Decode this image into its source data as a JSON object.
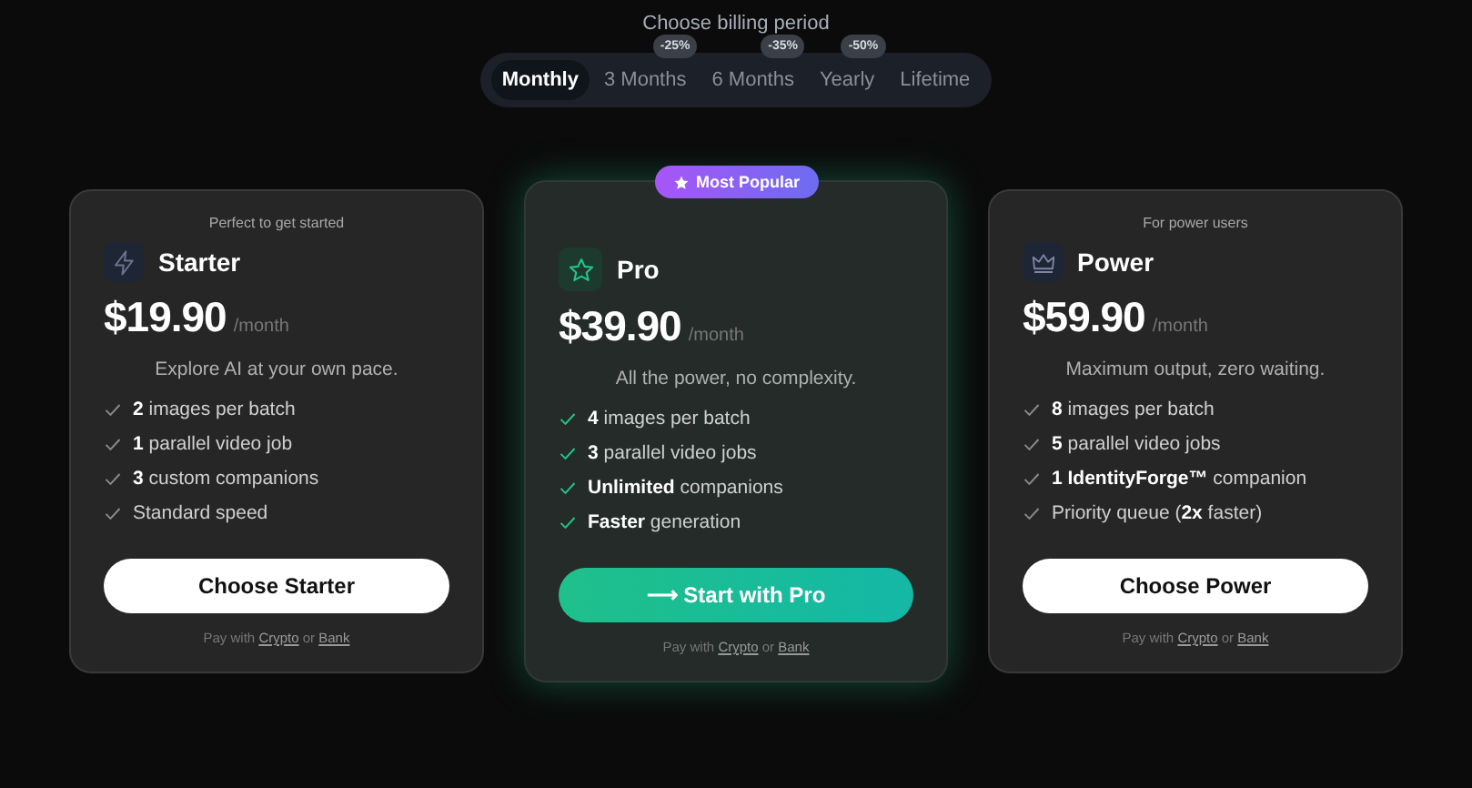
{
  "billing": {
    "heading": "Choose billing period",
    "periods": [
      {
        "label": "Monthly",
        "selected": true
      },
      {
        "label": "3 Months",
        "selected": false,
        "discount": "-25%"
      },
      {
        "label": "6 Months",
        "selected": false,
        "discount": "-35%"
      },
      {
        "label": "Yearly",
        "selected": false,
        "discount": "-50%"
      },
      {
        "label": "Lifetime",
        "selected": false
      }
    ]
  },
  "plans": [
    {
      "tagline": "Perfect to get started",
      "name": "Starter",
      "price": "$19.90",
      "unit": "/month",
      "description": "Explore AI at your own pace.",
      "featured": false,
      "features": [
        "**2** images per batch",
        "**1** parallel video job",
        "**3** custom companions",
        "Standard speed"
      ],
      "button": "Choose Starter",
      "pay": {
        "prefix": "Pay with",
        "link_1": "Crypto",
        "joiner": "or",
        "link_2": "Bank"
      }
    },
    {
      "badge": "Most Popular",
      "name": "Pro",
      "price": "$39.90",
      "unit": "/month",
      "description": "All the power, no complexity.",
      "featured": true,
      "features": [
        "**4** images per batch",
        "**3** parallel video jobs",
        "**Unlimited** companions",
        "**Faster** generation"
      ],
      "button": "⟶ Start with Pro",
      "pay": {
        "prefix": "Pay with",
        "link_1": "Crypto",
        "joiner": "or",
        "link_2": "Bank"
      }
    },
    {
      "tagline": "For power users",
      "name": "Power",
      "price": "$59.90",
      "unit": "/month",
      "description": "Maximum output, zero waiting.",
      "featured": false,
      "features": [
        "**8** images per batch",
        "**5** parallel video jobs",
        "**1 IdentityForge™** companion",
        "Priority queue (**2x** faster)"
      ],
      "button": "Choose Power",
      "pay": {
        "prefix": "Pay with",
        "link_1": "Crypto",
        "joiner": "or",
        "link_2": "Bank"
      }
    }
  ]
}
